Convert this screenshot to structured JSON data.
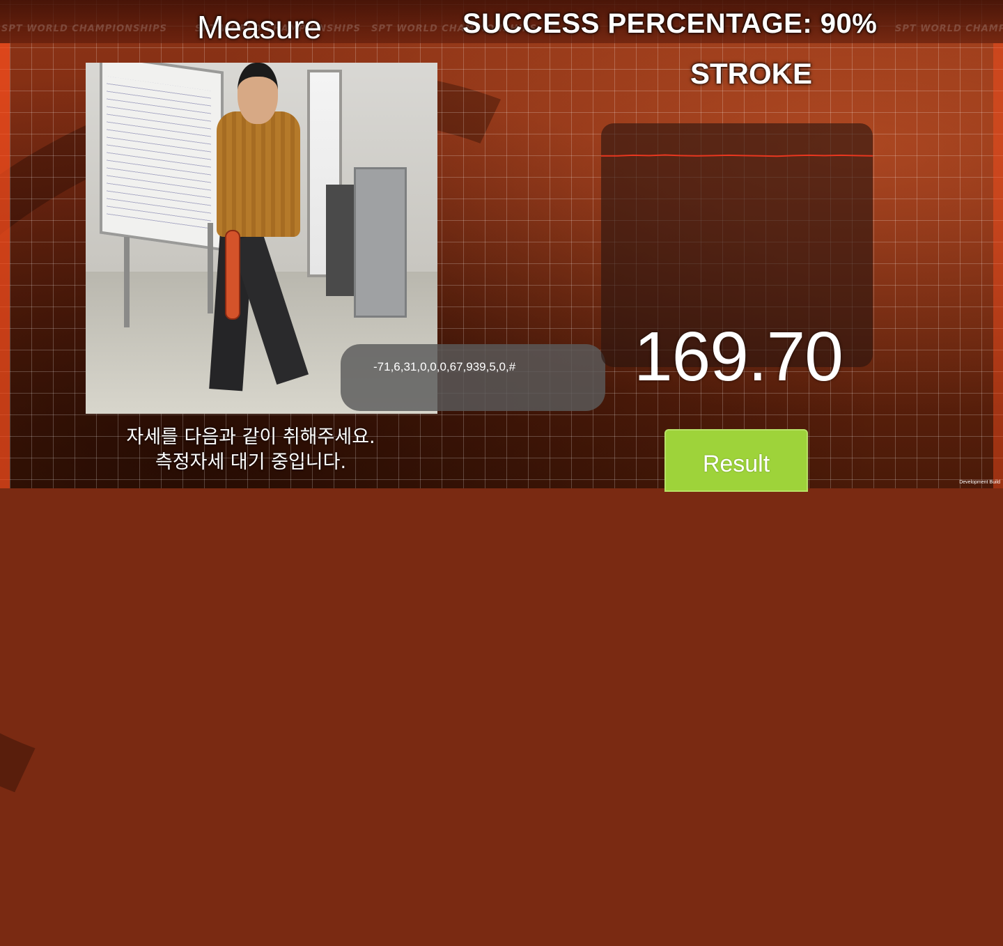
{
  "header": {
    "title": "Measure",
    "success_label": "SUCCESS PERCENTAGE: 90%",
    "watermark_text": "SPT WORLD CHAMPIONSHIPS"
  },
  "graph": {
    "label": "STROKE",
    "line_color": "#e8371f",
    "values": [
      0.52,
      0.52,
      0.51,
      0.515,
      0.505,
      0.515,
      0.52,
      0.515,
      0.51,
      0.515,
      0.52,
      0.525,
      0.515,
      0.51,
      0.515,
      0.51,
      0.515,
      0.52
    ]
  },
  "measurement": {
    "value": "169.70"
  },
  "console": {
    "text": "-71,6,31,0,0,0,67,939,5,0,#"
  },
  "instructions": {
    "line1": "자세를 다음과 같이 취해주세요.",
    "line2": "측정자세 대기 중입니다."
  },
  "result_button": {
    "label": "Result",
    "color": "#9ed33a"
  },
  "footer": {
    "build_label": "Development Build"
  }
}
